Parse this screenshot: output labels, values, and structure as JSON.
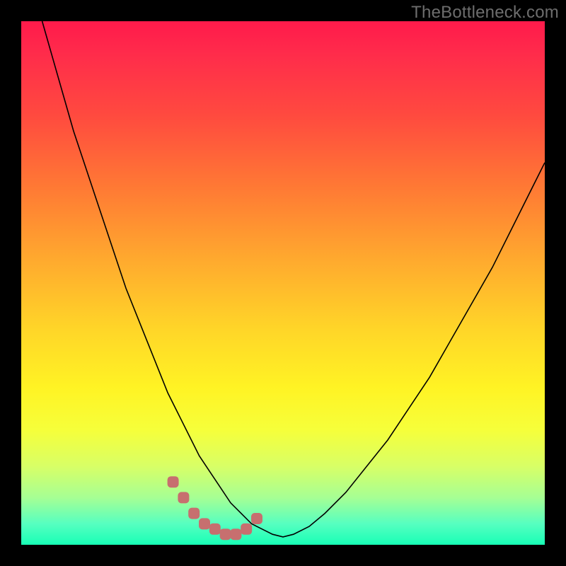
{
  "watermark": "TheBottleneck.com",
  "colors": {
    "gradient_top": "#ff1a4b",
    "gradient_bottom": "#18ffb6",
    "curve": "#000000",
    "markers": "#c76f6f",
    "frame": "#000000"
  },
  "chart_data": {
    "type": "line",
    "title": "",
    "xlabel": "",
    "ylabel": "",
    "xlim": [
      0,
      100
    ],
    "ylim": [
      0,
      100
    ],
    "grid": false,
    "legend": false,
    "series": [
      {
        "name": "bottleneck-curve",
        "x": [
          4,
          6,
          8,
          10,
          12,
          14,
          16,
          18,
          20,
          22,
          24,
          26,
          28,
          30,
          32,
          34,
          36,
          38,
          40,
          42,
          44,
          46,
          48,
          50,
          52,
          55,
          58,
          62,
          66,
          70,
          74,
          78,
          82,
          86,
          90,
          94,
          98,
          100
        ],
        "y": [
          100,
          93,
          86,
          79,
          73,
          67,
          61,
          55,
          49,
          44,
          39,
          34,
          29,
          25,
          21,
          17,
          14,
          11,
          8,
          6,
          4,
          3,
          2,
          1.5,
          2,
          3.5,
          6,
          10,
          15,
          20,
          26,
          32,
          39,
          46,
          53,
          61,
          69,
          73
        ]
      }
    ],
    "markers": {
      "name": "highlight-points",
      "x": [
        29,
        31,
        33,
        35,
        37,
        39,
        41,
        43,
        45
      ],
      "y": [
        12,
        9,
        6,
        4,
        3,
        2,
        2,
        3,
        5
      ]
    }
  }
}
